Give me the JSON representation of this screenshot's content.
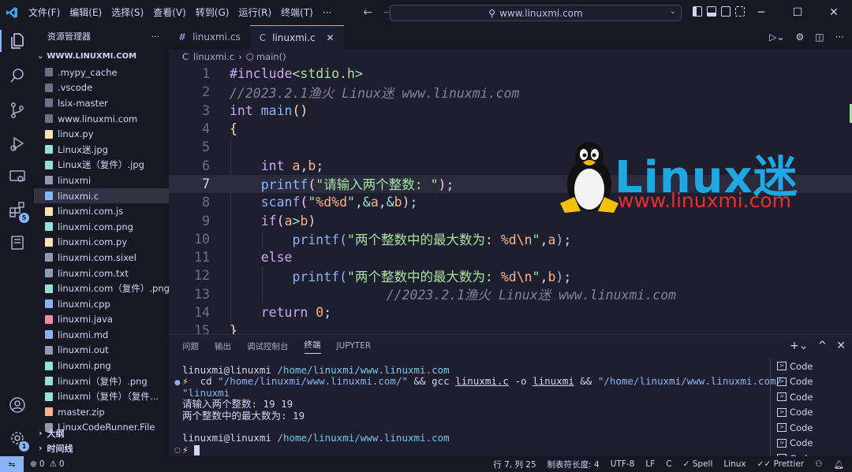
{
  "titlebar": {
    "menu": [
      "文件(F)",
      "编辑(E)",
      "选择(S)",
      "查看(V)",
      "转到(G)",
      "运行(R)",
      "终端(T)",
      "···"
    ],
    "search": "www.linuxmi.com",
    "controls": [
      "─",
      "☐",
      "✕"
    ]
  },
  "sidebar": {
    "title": "资源管理器",
    "root": "WWW.LINUXMI.COM",
    "files": [
      {
        "name": ".mypy_cache",
        "icon": "folder"
      },
      {
        "name": ".vscode",
        "icon": "folder"
      },
      {
        "name": "lsix-master",
        "icon": "folder"
      },
      {
        "name": "www.linuxmi.com",
        "icon": "folder"
      },
      {
        "name": "linux.py",
        "icon": "python"
      },
      {
        "name": "Linux迷.jpg",
        "icon": "image"
      },
      {
        "name": "Linux迷（复件）.jpg",
        "icon": "image"
      },
      {
        "name": "linuxmi",
        "icon": "file"
      },
      {
        "name": "linuxmi.c",
        "icon": "c"
      },
      {
        "name": "linuxmi.com.js",
        "icon": "js"
      },
      {
        "name": "linuxmi.com.png",
        "icon": "image"
      },
      {
        "name": "linuxmi.com.py",
        "icon": "python"
      },
      {
        "name": "linuxmi.com.sixel",
        "icon": "file"
      },
      {
        "name": "linuxmi.com.txt",
        "icon": "text"
      },
      {
        "name": "linuxmi.com（复件）.png",
        "icon": "image"
      },
      {
        "name": "linuxmi.cpp",
        "icon": "cpp"
      },
      {
        "name": "linuxmi.java",
        "icon": "java"
      },
      {
        "name": "linuxmi.md",
        "icon": "markdown"
      },
      {
        "name": "linuxmi.out",
        "icon": "file"
      },
      {
        "name": "linuxmi.png",
        "icon": "image"
      },
      {
        "name": "linuxmi（复件）.png",
        "icon": "image"
      },
      {
        "name": "linuxmi（复件）（复件...",
        "icon": "image"
      },
      {
        "name": "master.zip",
        "icon": "zip"
      },
      {
        "name": "LinuxCodeRunner.File",
        "icon": "file"
      }
    ],
    "outline": "大纲",
    "timeline": "时间线",
    "scm_badge": "5",
    "settings_badge": "1"
  },
  "tabs": [
    {
      "icon": "#",
      "label": "linuxmi.cs",
      "active": false
    },
    {
      "icon": "C",
      "label": "linuxmi.c",
      "active": true
    }
  ],
  "breadcrumb": {
    "file": "linuxmi.c",
    "symbol": "main()"
  },
  "editor": {
    "current_line": 7,
    "line_numbers": [
      "1",
      "2",
      "3",
      "4",
      "5",
      "6",
      "7",
      "8",
      "9",
      "10",
      "11",
      "12",
      "13",
      "14",
      "15"
    ]
  },
  "watermark": {
    "brand": "Linux迷",
    "url": "www.linuxmi.com"
  },
  "panel": {
    "tabs": [
      "问题",
      "输出",
      "调试控制台",
      "终端",
      "JUPYTER"
    ],
    "active_tab": "终端",
    "terminal_list": [
      "Code",
      "Code",
      "Code",
      "Code",
      "Code",
      "Code",
      "Code"
    ]
  },
  "terminal": {
    "user": "linuxmi@linuxmi",
    "path": "/home/linuxmi/www.linuxmi.com",
    "prompt": "⚡",
    "out1": "请输入两个整数: 19 19",
    "out2": "两个整数中的最大数为: 19"
  },
  "statusbar": {
    "errors": "0",
    "warnings": "0",
    "position": "行 7, 列 25",
    "tabsize": "制表符长度: 4",
    "encoding": "UTF-8",
    "eol": "LF",
    "lang": "C",
    "spell": "Spell",
    "os": "Linux",
    "formatter": "Prettier"
  },
  "colors": {
    "accent": "#89b4fa",
    "background": "#1e1e2e",
    "sidebar": "#181825"
  }
}
